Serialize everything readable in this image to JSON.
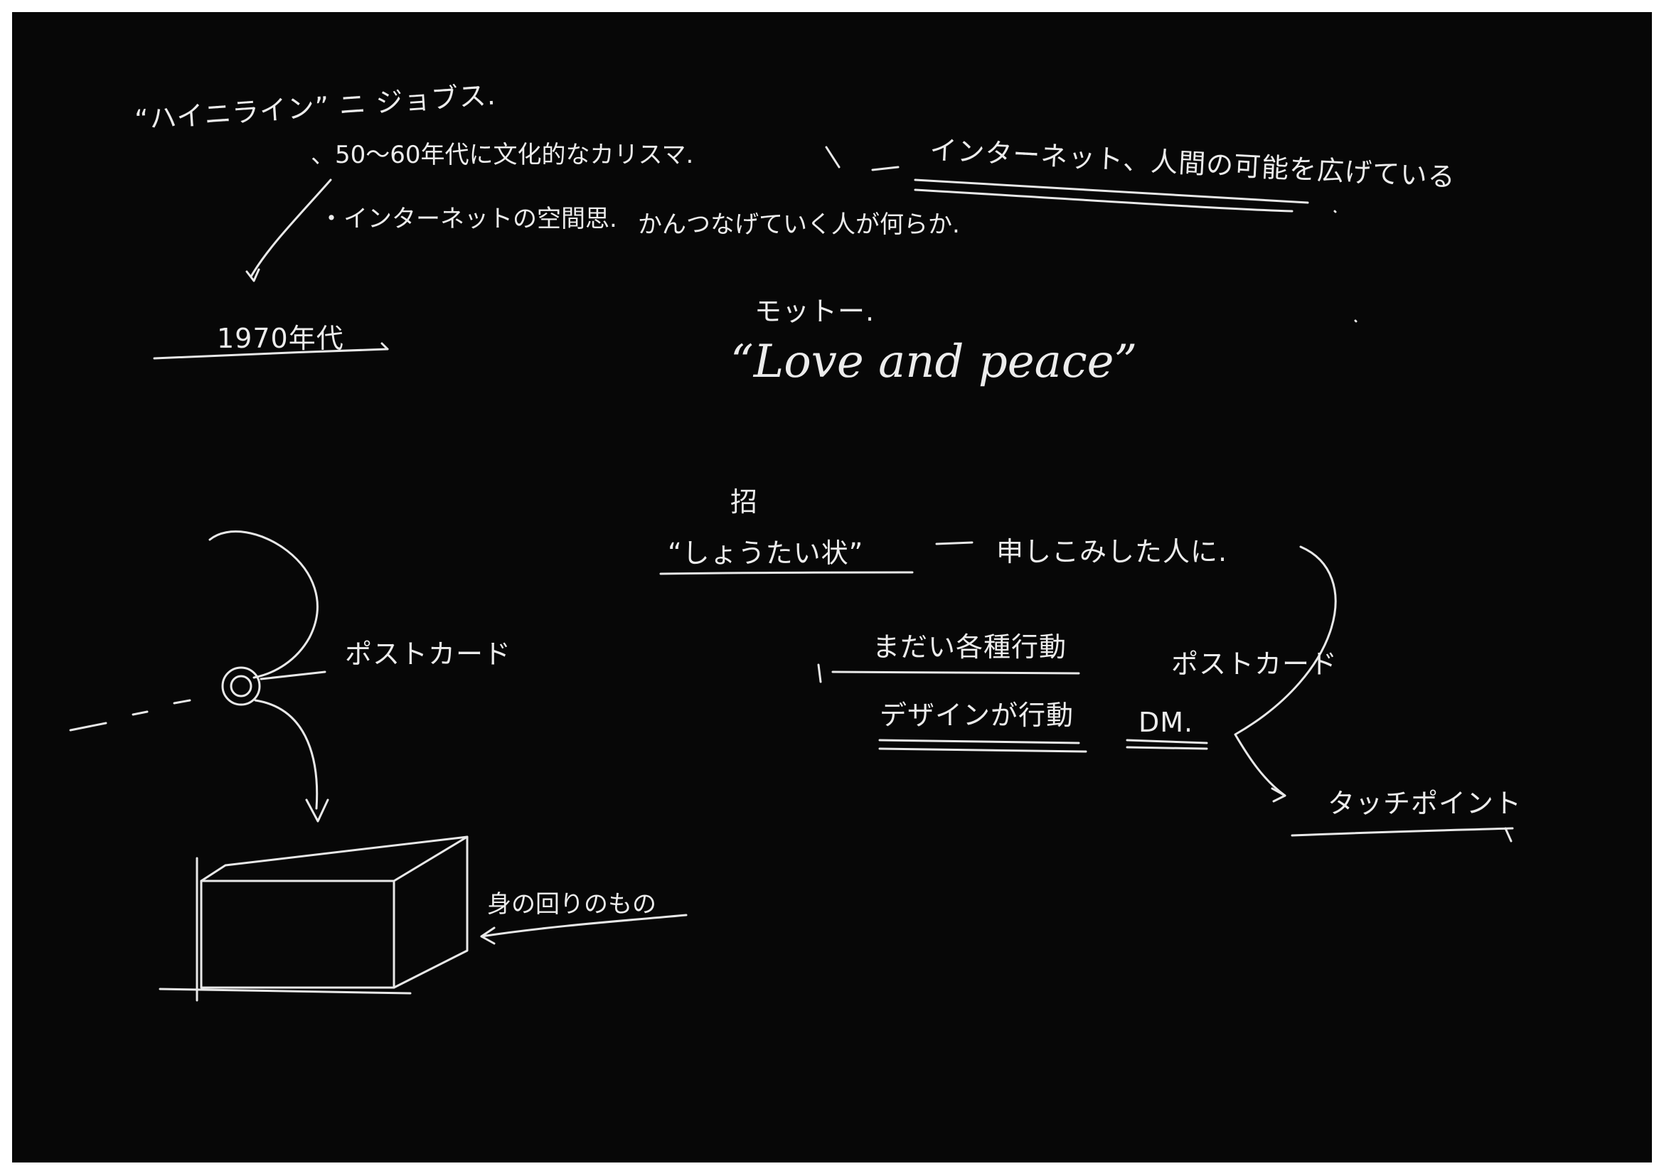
{
  "notes": {
    "heinlein": "“ハイニライン” ニ ジョブス.",
    "era_50_60": "、50〜60年代に文化的なカリスマ.",
    "internet_thought": "・インターネットの空間思.",
    "year_1970": "1970年代",
    "internet_extension": "インターネット、人間の可能を広げている",
    "connecting_people": "かんつなげていく人が何らか.",
    "motto": "モットー.",
    "love_and_peace": "“Love and peace”",
    "mark": "招",
    "invitation_quote": "“しょうたい状”",
    "applied_people": "申しこみした人に.",
    "postcard_left": "ポストカード",
    "kanji_label": "身の回りのもの",
    "action_1": "まだい各種行動",
    "postcard_right": "ポストカード",
    "action_2": "デザインが行動",
    "dm": "DM.",
    "touchpoint": "タッチポイント"
  }
}
